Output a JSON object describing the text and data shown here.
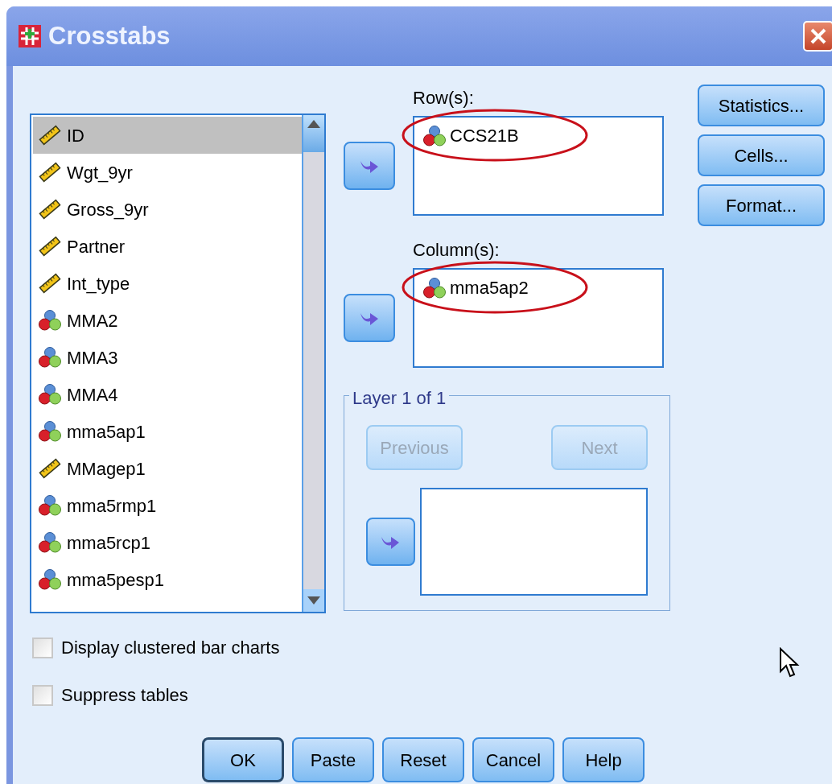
{
  "window": {
    "title": "Crosstabs"
  },
  "variables": [
    {
      "name": "ID",
      "kind": "scale",
      "selected": true
    },
    {
      "name": "Wgt_9yr",
      "kind": "scale",
      "selected": false
    },
    {
      "name": "Gross_9yr",
      "kind": "scale",
      "selected": false
    },
    {
      "name": "Partner",
      "kind": "scale",
      "selected": false
    },
    {
      "name": "Int_type",
      "kind": "scale",
      "selected": false
    },
    {
      "name": "MMA2",
      "kind": "nominal",
      "selected": false
    },
    {
      "name": "MMA3",
      "kind": "nominal",
      "selected": false
    },
    {
      "name": "MMA4",
      "kind": "nominal",
      "selected": false
    },
    {
      "name": "mma5ap1",
      "kind": "nominal",
      "selected": false
    },
    {
      "name": "MMagep1",
      "kind": "scale",
      "selected": false
    },
    {
      "name": "mma5rmp1",
      "kind": "nominal",
      "selected": false
    },
    {
      "name": "mma5rcp1",
      "kind": "nominal",
      "selected": false
    },
    {
      "name": "mma5pesp1",
      "kind": "nominal",
      "selected": false
    }
  ],
  "rows": {
    "label": "Row(s):",
    "items": [
      {
        "name": "CCS21B",
        "kind": "nominal",
        "circled": true
      }
    ]
  },
  "columns": {
    "label": "Column(s):",
    "items": [
      {
        "name": "mma5ap2",
        "kind": "nominal",
        "circled": true
      }
    ]
  },
  "layer": {
    "title": "Layer 1 of 1",
    "previous": {
      "label": "Previous",
      "disabled": true
    },
    "next": {
      "label": "Next",
      "disabled": true
    }
  },
  "side_buttons": [
    "Statistics...",
    "Cells...",
    "Format..."
  ],
  "options": [
    {
      "label": "Display clustered bar charts",
      "checked": false
    },
    {
      "label": "Suppress tables",
      "checked": false
    }
  ],
  "buttons": [
    {
      "label": "OK",
      "default": true
    },
    {
      "label": "Paste",
      "default": false
    },
    {
      "label": "Reset",
      "default": false
    },
    {
      "label": "Cancel",
      "default": false
    },
    {
      "label": "Help",
      "default": false
    }
  ]
}
